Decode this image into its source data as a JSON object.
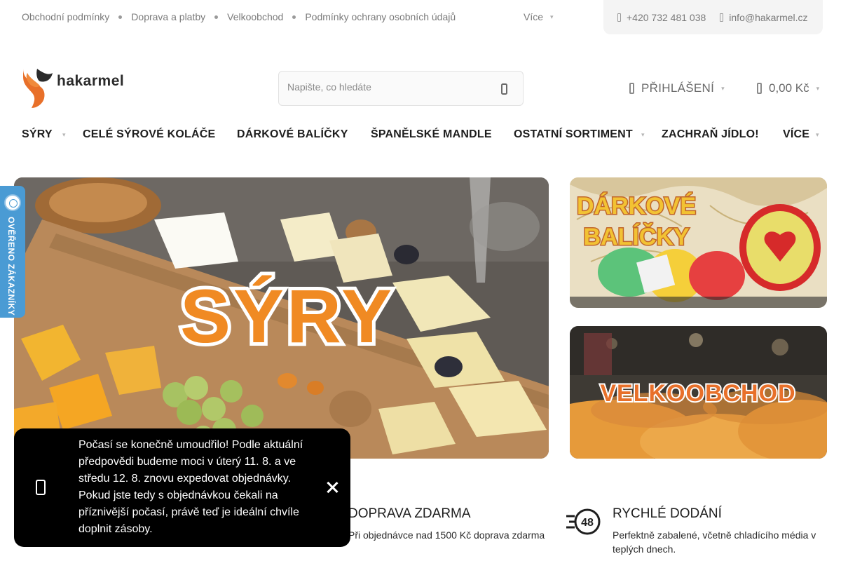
{
  "topbar": {
    "links": [
      "Obchodní podmínky",
      "Doprava a platby",
      "Velkoobchod",
      "Podmínky ochrany osobních údajů"
    ],
    "more": "Více",
    "phone": "+420 732 481 038",
    "email": "info@hakarmel.cz"
  },
  "header": {
    "logo_text": "hakarmel",
    "search_placeholder": "Napište, co hledáte",
    "login": "PŘIHLÁŠENÍ",
    "cart_total": "0,00 Kč"
  },
  "nav": {
    "items": [
      "SÝRY",
      "CELÉ SÝROVÉ KOLÁČE",
      "DÁRKOVÉ BALÍČKY",
      "ŠPANĚLSKÉ MANDLE",
      "OSTATNÍ SORTIMENT",
      "ZACHRAŇ JÍDLO!",
      "VÍCE"
    ]
  },
  "banners": {
    "main": "SÝRY",
    "gift_line1": "DÁRKOVÉ",
    "gift_line2": "BALÍČKY",
    "wholesale": "VELKOOBCHOD"
  },
  "badge": {
    "text": "OVĚŘENO ZÁKAZNÍKY"
  },
  "features": [
    {
      "title": "DOPRAVA ZDARMA",
      "text": "Při objednávce nad 1500 Kč doprava zdarma"
    },
    {
      "title": "RYCHLÉ DODÁNÍ",
      "text": "Perfektně zabalené, včetně chladícího média v teplých dnech.",
      "icon_label": "48"
    }
  ],
  "toast": {
    "message": "Počasí se konečně umoudřilo!  Podle aktuální předpovědi budeme moci v úterý 11. 8. a ve středu 12. 8. znovu expedovat objednávky. Pokud jste tedy s objednávkou čekali na příznivější počasí, právě teď je ideální chvíle doplnit zásoby."
  },
  "colors": {
    "brand_orange": "#e8702a",
    "badge_blue": "#4a9bd4",
    "toast_bg": "#000000"
  }
}
